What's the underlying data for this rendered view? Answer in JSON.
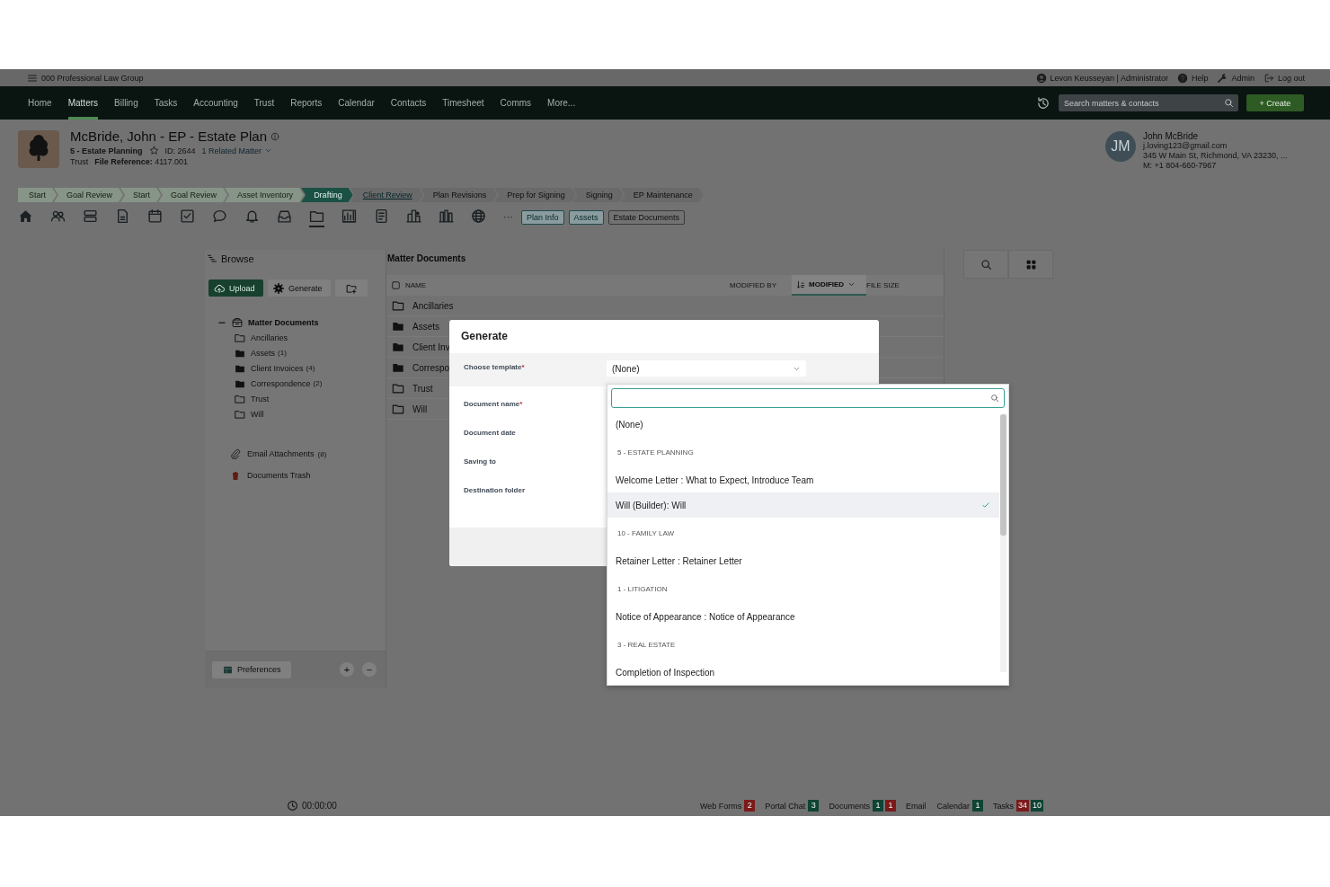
{
  "org": {
    "name": "000 Professional Law Group"
  },
  "user_menu": [
    {
      "kind": "user",
      "label": "Levon Keusseyan | Administrator"
    },
    {
      "kind": "help",
      "label": "Help"
    },
    {
      "kind": "admin",
      "label": "Admin"
    },
    {
      "kind": "logout",
      "label": "Log out"
    }
  ],
  "nav": {
    "items": [
      {
        "label": "Home",
        "selected": false
      },
      {
        "label": "Matters",
        "selected": true
      },
      {
        "label": "Billing",
        "selected": false
      },
      {
        "label": "Tasks",
        "selected": false
      },
      {
        "label": "Accounting",
        "selected": false
      },
      {
        "label": "Trust",
        "selected": false
      },
      {
        "label": "Reports",
        "selected": false
      },
      {
        "label": "Calendar",
        "selected": false
      },
      {
        "label": "Contacts",
        "selected": false
      },
      {
        "label": "Timesheet",
        "selected": false
      },
      {
        "label": "Comms",
        "selected": false
      },
      {
        "label": "More...",
        "selected": false
      }
    ],
    "search": {
      "placeholder": "Search matters & contacts"
    },
    "create_button": "+ Create"
  },
  "matter": {
    "title": "McBride, John - EP - Estate Plan",
    "practice_area": "5 - Estate Planning",
    "starred": false,
    "id": "ID: 2644",
    "related": "1 Related Matter",
    "type": "Trust",
    "file_reference": "**File Reference:** 4117.001"
  },
  "contact": {
    "initials": "JM",
    "name": "John McBride",
    "email": "j.loving123@gmail.com",
    "address": "345 W Main St, Richmond, VA 23230, ...",
    "phone": "M: +1 804-660-7967"
  },
  "stages": [
    {
      "label": "Start",
      "kind": "done"
    },
    {
      "label": "Goal Review",
      "kind": "done"
    },
    {
      "label": "Start",
      "kind": "done"
    },
    {
      "label": "Goal Review",
      "kind": "done"
    },
    {
      "label": "Asset Inventory",
      "kind": "done"
    },
    {
      "label": "Drafting",
      "kind": "current"
    },
    {
      "label": "Client Review",
      "kind": "next"
    },
    {
      "label": "Plan Revisions",
      "kind": "todo"
    },
    {
      "label": "Prep for Signing",
      "kind": "todo"
    },
    {
      "label": "Signing",
      "kind": "todo"
    },
    {
      "label": "EP Maintenance",
      "kind": "todo"
    }
  ],
  "tools": [
    {
      "kind": "home",
      "selected": false
    },
    {
      "kind": "people",
      "selected": false
    },
    {
      "kind": "stack",
      "selected": false
    },
    {
      "kind": "document",
      "selected": false
    },
    {
      "kind": "calendar",
      "selected": false
    },
    {
      "kind": "checkbox",
      "selected": false
    },
    {
      "kind": "chat",
      "selected": false
    },
    {
      "kind": "bell",
      "selected": false
    },
    {
      "kind": "inbox",
      "selected": false
    },
    {
      "kind": "folder",
      "selected": true
    },
    {
      "kind": "chart",
      "selected": false
    },
    {
      "kind": "ledger",
      "selected": false
    },
    {
      "kind": "buildings",
      "selected": false
    },
    {
      "kind": "columns",
      "selected": false
    },
    {
      "kind": "globe",
      "selected": false
    },
    {
      "kind": "more",
      "label": "···",
      "selected": false
    }
  ],
  "tool_tabs": [
    {
      "label": "Plan Info",
      "highlighted": true
    },
    {
      "label": "Assets",
      "highlighted": true
    },
    {
      "label": "Estate Documents",
      "highlighted": false
    }
  ],
  "browse": {
    "title": "Browse",
    "upload": "Upload",
    "generate": "Generate",
    "tree": [
      {
        "label": "Matter Documents",
        "expanded": true,
        "children": [
          {
            "label": "Ancillaries",
            "has_files": false
          },
          {
            "label": "Assets",
            "count": "(1)",
            "has_files": true
          },
          {
            "label": "Client Invoices",
            "count": "(4)",
            "has_files": true
          },
          {
            "label": "Correspondence",
            "count": "(2)",
            "has_files": true
          },
          {
            "label": "Trust",
            "has_files": false
          },
          {
            "label": "Will",
            "has_files": false
          }
        ]
      }
    ],
    "extras": [
      {
        "kind": "attachments",
        "label": "Email Attachments",
        "count": "(8)"
      },
      {
        "kind": "trash",
        "label": "Documents Trash"
      }
    ],
    "preferences": "Preferences",
    "zoom_buttons": [
      "+",
      "−"
    ]
  },
  "documents": {
    "title": "Matter Documents",
    "select_all_checked": false,
    "columns": [
      {
        "label": "NAME",
        "sorted": false
      },
      {
        "label": "MODIFIED BY",
        "sorted": false
      },
      {
        "label": "MODIFIED",
        "sorted": true
      },
      {
        "label": "FILE SIZE",
        "sorted": false
      }
    ],
    "rows": [
      {
        "name": "Ancillaries",
        "has_files": false
      },
      {
        "name": "Assets",
        "has_files": true
      },
      {
        "name": "Client Inv",
        "has_files": true
      },
      {
        "name": "Correspo",
        "has_files": true
      },
      {
        "name": "Trust",
        "has_files": false
      },
      {
        "name": "Will",
        "has_files": false
      }
    ]
  },
  "timer": "00:00:00",
  "status_bar": [
    {
      "label": "Web Forms",
      "badges": [
        {
          "text": "2",
          "color": "#7a1a1a"
        }
      ]
    },
    {
      "label": "Portal Chat",
      "badges": [
        {
          "text": "3",
          "color": "#0f4434"
        }
      ]
    },
    {
      "label": "Documents",
      "badges": [
        {
          "text": "1",
          "color": "#0f4434"
        },
        {
          "text": "1",
          "color": "#7a1a1a"
        }
      ]
    },
    {
      "label": "Email"
    },
    {
      "label": "Calendar",
      "badges": [
        {
          "text": "1",
          "color": "#0f4434"
        }
      ]
    },
    {
      "label": "Tasks",
      "badges": [
        {
          "text": "34",
          "color": "#7a1a1a"
        },
        {
          "text": "10",
          "color": "#0f4434"
        }
      ]
    }
  ],
  "dialog": {
    "title": "Generate",
    "fields": [
      {
        "kind": "select",
        "label": "Choose template",
        "mark": "*",
        "value": "(None)"
      },
      {
        "kind": "text",
        "label": "Document name",
        "mark": "*"
      },
      {
        "kind": "text",
        "label": "Document date"
      },
      {
        "kind": "text",
        "label": "Saving to"
      },
      {
        "kind": "text",
        "label": "Destination folder"
      }
    ]
  },
  "dropdown": {
    "options": [
      {
        "kind": "option",
        "label": "(None)",
        "selected": false
      },
      {
        "kind": "group",
        "label": "5 - ESTATE PLANNING"
      },
      {
        "kind": "option",
        "label": "Welcome Letter : What to Expect, Introduce Team",
        "selected": false
      },
      {
        "kind": "option",
        "label": "Will (Builder): Will",
        "selected": true
      },
      {
        "kind": "group",
        "label": "10 - FAMILY LAW"
      },
      {
        "kind": "option",
        "label": "Retainer Letter : Retainer Letter",
        "selected": false
      },
      {
        "kind": "group",
        "label": "1 - LITIGATION"
      },
      {
        "kind": "option",
        "label": "Notice of Appearance : Notice of Appearance",
        "selected": false
      },
      {
        "kind": "group",
        "label": "3 - REAL ESTATE"
      },
      {
        "kind": "option",
        "label": "Completion of Inspection",
        "selected": false
      }
    ]
  }
}
